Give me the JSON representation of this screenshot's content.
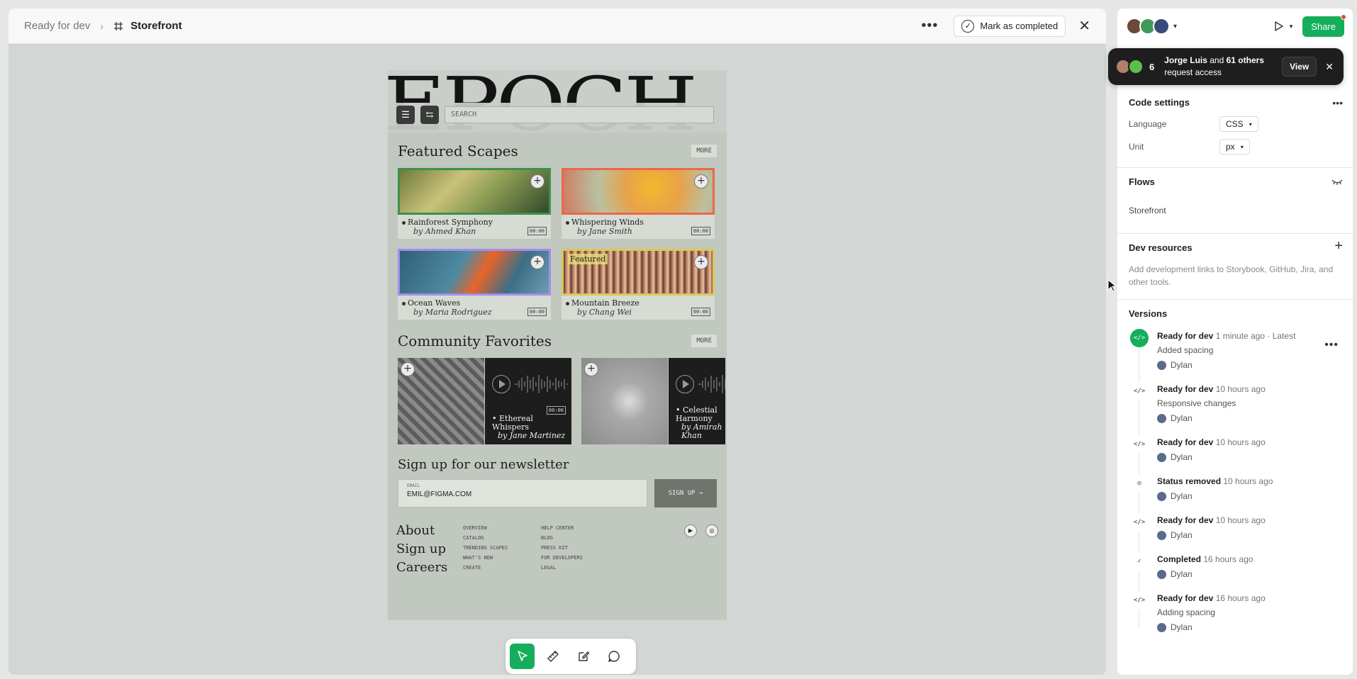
{
  "topbar": {
    "status": "Ready for dev",
    "frame_name": "Storefront",
    "mark_completed": "Mark as completed"
  },
  "design": {
    "hero_title": "EPOCH",
    "search_placeholder": "SEARCH",
    "featured_title": "Featured Scapes",
    "more_label": "MORE",
    "featured_tag": "Featured",
    "cards": [
      {
        "title": "Rainforest Symphony",
        "by": "by Ahmed Khan",
        "time": "00:00",
        "border": "#3f8f4a",
        "bg": "linear-gradient(135deg,#6f7a3e 0%,#c9c27a 35%,#8a9a52 60%,#2f4a2c 100%)"
      },
      {
        "title": "Whispering Winds",
        "by": "by Jane Smith",
        "time": "00:00",
        "border": "#e8694a",
        "bg": "radial-gradient(circle at 60% 40%,#f4b82c 0%,#e7a24a 30%,#b9c1a0 60%,#d07a62 100%)"
      },
      {
        "title": "Ocean Waves",
        "by": "by Maria Rodriguez",
        "time": "00:00",
        "border": "#a58cf0",
        "bg": "linear-gradient(120deg,#2f5f7a 0%,#4f8aa0 40%,#e8642a 55%,#3a6f86 75%,#6f9cb0 100%)"
      },
      {
        "title": "Mountain Breeze",
        "by": "by Chang Wei",
        "time": "00:00",
        "border": "#d9c957",
        "bg": "repeating-linear-gradient(90deg,#5a3a2a 0px,#c98a6a 4px,#eac2a2 7px,#7a4a3a 10px)"
      }
    ],
    "community_title": "Community Favorites",
    "community": [
      {
        "title": "Ethereal Whispers",
        "by": "by Jane Martinez",
        "time": "00:00"
      },
      {
        "title": "Celestial Harmony",
        "by": "by Amirah Khan"
      }
    ],
    "newsletter_title": "Sign up for our newsletter",
    "email_label": "EMAIL",
    "email_value": "EMIL@FIGMA.COM",
    "signup_label": "SIGN UP →",
    "footer_big": [
      "About",
      "Sign up",
      "Careers"
    ],
    "footer_col1": [
      "OVERVIEW",
      "CATALOG",
      "TRENDING SCAPES",
      "WHAT'S NEW",
      "CREATE"
    ],
    "footer_col2": [
      "HELP CENTER",
      "BLOG",
      "PRESS KIT",
      "FOR DEVELOPERS",
      "LEGAL"
    ]
  },
  "panel": {
    "share_label": "Share",
    "toast": {
      "count": "6",
      "name": "Jorge Luis",
      "and": " and ",
      "others": "61 others",
      "request": "request access",
      "view": "View"
    },
    "code_settings": {
      "title": "Code settings",
      "language_label": "Language",
      "language_value": "CSS",
      "unit_label": "Unit",
      "unit_value": "px"
    },
    "flows": {
      "title": "Flows",
      "item": "Storefront"
    },
    "dev_resources": {
      "title": "Dev resources",
      "desc": "Add development links to Storybook, GitHub, Jira, and other tools."
    },
    "versions_title": "Versions",
    "versions": [
      {
        "status": "Ready for dev",
        "time": "1 minute ago · Latest",
        "desc": "Added spacing",
        "user": "Dylan",
        "icon": "</>",
        "green": true
      },
      {
        "status": "Ready for dev",
        "time": "10 hours ago",
        "desc": "Responsive changes",
        "user": "Dylan",
        "icon": "</>",
        "green": false
      },
      {
        "status": "Ready for dev",
        "time": "10 hours ago",
        "desc": "",
        "user": "Dylan",
        "icon": "</>",
        "green": false
      },
      {
        "status": "Status removed",
        "time": "10 hours ago",
        "desc": "",
        "user": "Dylan",
        "icon": "◎",
        "green": false
      },
      {
        "status": "Ready for dev",
        "time": "10 hours ago",
        "desc": "",
        "user": "Dylan",
        "icon": "</>",
        "green": false
      },
      {
        "status": "Completed",
        "time": "16 hours ago",
        "desc": "",
        "user": "Dylan",
        "icon": "✓",
        "green": false
      },
      {
        "status": "Ready for dev",
        "time": "16 hours ago",
        "desc": "Adding spacing",
        "user": "Dylan",
        "icon": "</>",
        "green": false
      }
    ]
  }
}
